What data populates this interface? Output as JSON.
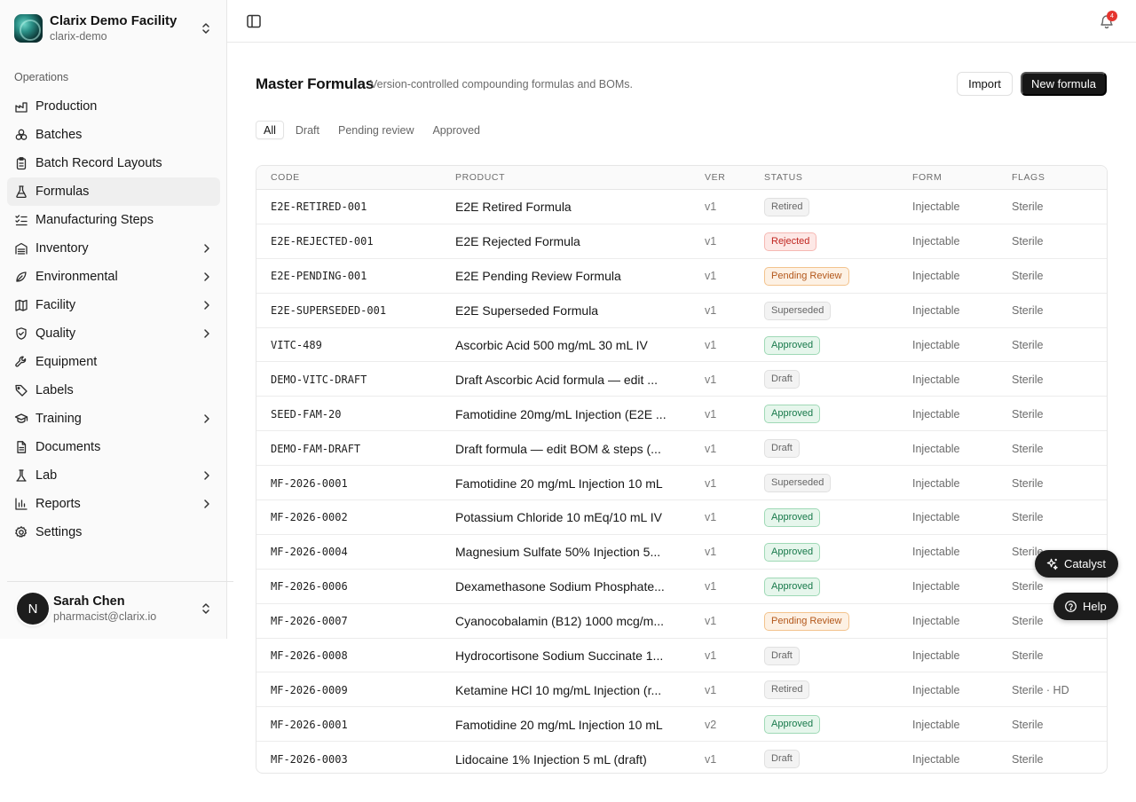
{
  "facility": {
    "name": "Clarix Demo Facility",
    "slug": "clarix-demo"
  },
  "sidebar": {
    "section_label": "Operations",
    "items": [
      {
        "label": "Production",
        "icon": "factory-icon",
        "has_children": false,
        "active": false
      },
      {
        "label": "Batches",
        "icon": "boxes-icon",
        "has_children": false,
        "active": false
      },
      {
        "label": "Batch Record Layouts",
        "icon": "clipboard-icon",
        "has_children": false,
        "active": false
      },
      {
        "label": "Formulas",
        "icon": "flask-icon",
        "has_children": false,
        "active": true
      },
      {
        "label": "Manufacturing Steps",
        "icon": "list-checks-icon",
        "has_children": false,
        "active": false
      },
      {
        "label": "Inventory",
        "icon": "warehouse-icon",
        "has_children": true,
        "active": false
      },
      {
        "label": "Environmental",
        "icon": "leaf-icon",
        "has_children": true,
        "active": false
      },
      {
        "label": "Facility",
        "icon": "map-icon",
        "has_children": true,
        "active": false
      },
      {
        "label": "Quality",
        "icon": "shield-check-icon",
        "has_children": true,
        "active": false
      },
      {
        "label": "Equipment",
        "icon": "wrench-icon",
        "has_children": false,
        "active": false
      },
      {
        "label": "Labels",
        "icon": "tag-icon",
        "has_children": false,
        "active": false
      },
      {
        "label": "Training",
        "icon": "graduation-cap-icon",
        "has_children": true,
        "active": false
      },
      {
        "label": "Documents",
        "icon": "file-text-icon",
        "has_children": false,
        "active": false
      },
      {
        "label": "Lab",
        "icon": "test-tube-icon",
        "has_children": true,
        "active": false
      },
      {
        "label": "Reports",
        "icon": "bar-chart-icon",
        "has_children": true,
        "active": false
      },
      {
        "label": "Settings",
        "icon": "gear-icon",
        "has_children": false,
        "active": false
      }
    ]
  },
  "user": {
    "initial": "N",
    "name": "Sarah Chen",
    "email": "pharmacist@clarix.io"
  },
  "notifications": {
    "count": "4"
  },
  "page": {
    "title": "Master Formulas",
    "subtitle": "Version-controlled compounding formulas and BOMs.",
    "import_label": "Import",
    "new_label": "New formula"
  },
  "tabs": [
    {
      "label": "All",
      "active": true
    },
    {
      "label": "Draft",
      "active": false
    },
    {
      "label": "Pending review",
      "active": false
    },
    {
      "label": "Approved",
      "active": false
    }
  ],
  "table": {
    "columns": {
      "code": "CODE",
      "product": "PRODUCT",
      "ver": "VER",
      "status": "STATUS",
      "form": "FORM",
      "flags": "FLAGS"
    },
    "rows": [
      {
        "code": "E2E-RETIRED-001",
        "product": "E2E Retired Formula",
        "ver": "v1",
        "status": "Retired",
        "form": "Injectable",
        "flags": "Sterile"
      },
      {
        "code": "E2E-REJECTED-001",
        "product": "E2E Rejected Formula",
        "ver": "v1",
        "status": "Rejected",
        "form": "Injectable",
        "flags": "Sterile"
      },
      {
        "code": "E2E-PENDING-001",
        "product": "E2E Pending Review Formula",
        "ver": "v1",
        "status": "Pending Review",
        "form": "Injectable",
        "flags": "Sterile"
      },
      {
        "code": "E2E-SUPERSEDED-001",
        "product": "E2E Superseded Formula",
        "ver": "v1",
        "status": "Superseded",
        "form": "Injectable",
        "flags": "Sterile"
      },
      {
        "code": "VITC-489",
        "product": "Ascorbic Acid 500 mg/mL 30 mL IV",
        "ver": "v1",
        "status": "Approved",
        "form": "Injectable",
        "flags": "Sterile"
      },
      {
        "code": "DEMO-VITC-DRAFT",
        "product": "Draft Ascorbic Acid formula — edit ...",
        "ver": "v1",
        "status": "Draft",
        "form": "Injectable",
        "flags": "Sterile"
      },
      {
        "code": "SEED-FAM-20",
        "product": "Famotidine 20mg/mL Injection (E2E ...",
        "ver": "v1",
        "status": "Approved",
        "form": "Injectable",
        "flags": "Sterile"
      },
      {
        "code": "DEMO-FAM-DRAFT",
        "product": "Draft formula — edit BOM & steps (...",
        "ver": "v1",
        "status": "Draft",
        "form": "Injectable",
        "flags": "Sterile"
      },
      {
        "code": "MF-2026-0001",
        "product": "Famotidine 20 mg/mL Injection 10 mL",
        "ver": "v1",
        "status": "Superseded",
        "form": "Injectable",
        "flags": "Sterile"
      },
      {
        "code": "MF-2026-0002",
        "product": "Potassium Chloride 10 mEq/10 mL IV",
        "ver": "v1",
        "status": "Approved",
        "form": "Injectable",
        "flags": "Sterile"
      },
      {
        "code": "MF-2026-0004",
        "product": "Magnesium Sulfate 50% Injection 5...",
        "ver": "v1",
        "status": "Approved",
        "form": "Injectable",
        "flags": "Sterile"
      },
      {
        "code": "MF-2026-0006",
        "product": "Dexamethasone Sodium Phosphate...",
        "ver": "v1",
        "status": "Approved",
        "form": "Injectable",
        "flags": "Sterile"
      },
      {
        "code": "MF-2026-0007",
        "product": "Cyanocobalamin (B12) 1000 mcg/m...",
        "ver": "v1",
        "status": "Pending Review",
        "form": "Injectable",
        "flags": "Sterile"
      },
      {
        "code": "MF-2026-0008",
        "product": "Hydrocortisone Sodium Succinate 1...",
        "ver": "v1",
        "status": "Draft",
        "form": "Injectable",
        "flags": "Sterile"
      },
      {
        "code": "MF-2026-0009",
        "product": "Ketamine HCl 10 mg/mL Injection (r...",
        "ver": "v1",
        "status": "Retired",
        "form": "Injectable",
        "flags": "Sterile · HD"
      },
      {
        "code": "MF-2026-0001",
        "product": "Famotidine 20 mg/mL Injection 10 mL",
        "ver": "v2",
        "status": "Approved",
        "form": "Injectable",
        "flags": "Sterile"
      },
      {
        "code": "MF-2026-0003",
        "product": "Lidocaine 1% Injection 5 mL (draft)",
        "ver": "v1",
        "status": "Draft",
        "form": "Injectable",
        "flags": "Sterile"
      }
    ]
  },
  "floating": {
    "catalyst_label": "Catalyst",
    "help_label": "Help"
  }
}
